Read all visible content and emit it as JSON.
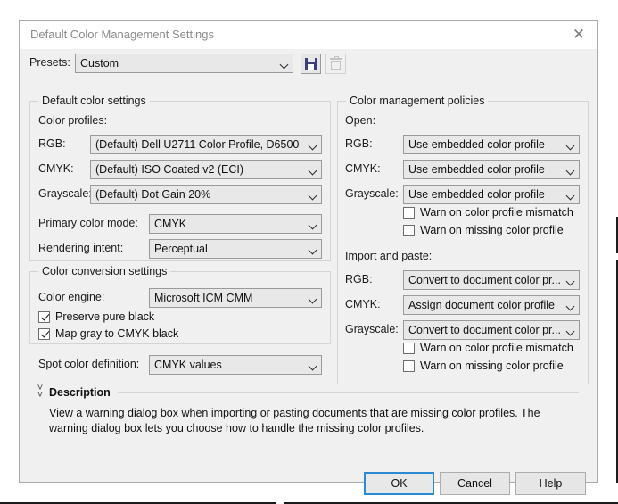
{
  "window": {
    "title": "Default Color Management Settings",
    "close_icon": "close-icon"
  },
  "presets": {
    "label": "Presets:",
    "value": "Custom",
    "save_icon": "floppy-disk-save-icon",
    "delete_icon": "trash-delete-icon"
  },
  "default_color_settings": {
    "title": "Default color settings",
    "color_profiles_label": "Color profiles:",
    "rows": [
      {
        "label": "RGB:",
        "value": "(Default) Dell U2711 Color Profile, D6500"
      },
      {
        "label": "CMYK:",
        "value": "(Default) ISO Coated v2 (ECI)"
      },
      {
        "label": "Grayscale:",
        "value": "(Default) Dot Gain 20%"
      }
    ],
    "primary_color_mode": {
      "label": "Primary color mode:",
      "value": "CMYK"
    },
    "rendering_intent": {
      "label": "Rendering intent:",
      "value": "Perceptual"
    }
  },
  "color_conversion_settings": {
    "title": "Color conversion settings",
    "color_engine": {
      "label": "Color engine:",
      "value": "Microsoft ICM CMM"
    },
    "checkboxes": [
      {
        "label": "Preserve pure black",
        "checked": true
      },
      {
        "label": "Map gray to CMYK black",
        "checked": true
      }
    ]
  },
  "spot_color_definition": {
    "label": "Spot color definition:",
    "value": "CMYK values"
  },
  "color_management_policies": {
    "title": "Color management policies",
    "open": {
      "label": "Open:",
      "rows": [
        {
          "label": "RGB:",
          "value": "Use embedded color profile"
        },
        {
          "label": "CMYK:",
          "value": "Use embedded color profile"
        },
        {
          "label": "Grayscale:",
          "value": "Use embedded color profile"
        }
      ],
      "checkboxes": [
        {
          "label": "Warn on color profile mismatch",
          "checked": false
        },
        {
          "label": "Warn on missing color profile",
          "checked": false
        }
      ]
    },
    "import_and_paste": {
      "label": "Import and paste:",
      "rows": [
        {
          "label": "RGB:",
          "value": "Convert to document color pr..."
        },
        {
          "label": "CMYK:",
          "value": "Assign document color profile"
        },
        {
          "label": "Grayscale:",
          "value": "Convert to document color pr..."
        }
      ],
      "checkboxes": [
        {
          "label": "Warn on color profile mismatch",
          "checked": false
        },
        {
          "label": "Warn on missing color profile",
          "checked": false
        }
      ]
    }
  },
  "description": {
    "collapse_icon": "double-chevron-up-icon",
    "title": "Description",
    "text": "View a warning dialog box when importing or pasting documents that are missing color profiles.  The warning dialog box lets you choose how to handle the missing color profiles."
  },
  "footer": {
    "ok": "OK",
    "cancel": "Cancel",
    "help": "Help"
  },
  "colors": {
    "accent_focus": "#2a8ad4",
    "dialog_bg": "#f0f0f0",
    "combo_bg": "#e8e8e8",
    "title_text": "#8a8a8a",
    "save_icon": "#3b3f76"
  }
}
